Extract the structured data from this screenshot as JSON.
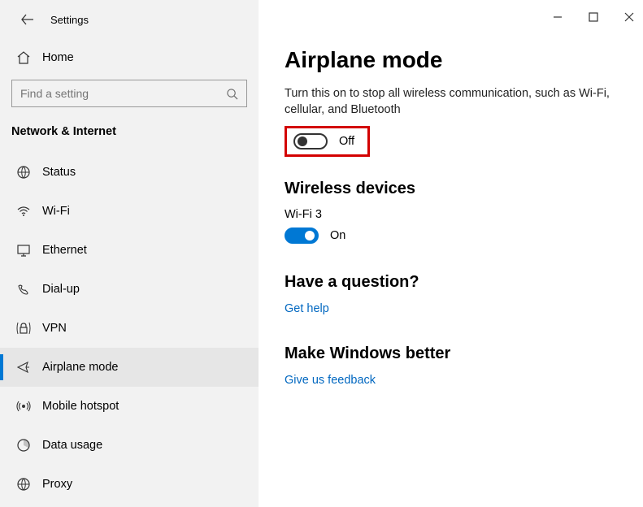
{
  "titlebar": {
    "title": "Settings"
  },
  "home": {
    "label": "Home"
  },
  "search": {
    "placeholder": "Find a setting"
  },
  "category": "Network & Internet",
  "nav": [
    {
      "label": "Status",
      "icon": "status-icon"
    },
    {
      "label": "Wi-Fi",
      "icon": "wifi-icon"
    },
    {
      "label": "Ethernet",
      "icon": "ethernet-icon"
    },
    {
      "label": "Dial-up",
      "icon": "dialup-icon"
    },
    {
      "label": "VPN",
      "icon": "vpn-icon"
    },
    {
      "label": "Airplane mode",
      "icon": "airplane-icon",
      "active": true
    },
    {
      "label": "Mobile hotspot",
      "icon": "hotspot-icon"
    },
    {
      "label": "Data usage",
      "icon": "datausage-icon"
    },
    {
      "label": "Proxy",
      "icon": "proxy-icon"
    }
  ],
  "page": {
    "title": "Airplane mode",
    "description": "Turn this on to stop all wireless communication, such as Wi-Fi, cellular, and Bluetooth",
    "airplane_toggle": {
      "state": "off",
      "label": "Off"
    },
    "wireless_heading": "Wireless devices",
    "wifi_device": {
      "name": "Wi-Fi 3",
      "state": "on",
      "label": "On"
    },
    "question_heading": "Have a question?",
    "help_link": "Get help",
    "feedback_heading": "Make Windows better",
    "feedback_link": "Give us feedback"
  }
}
